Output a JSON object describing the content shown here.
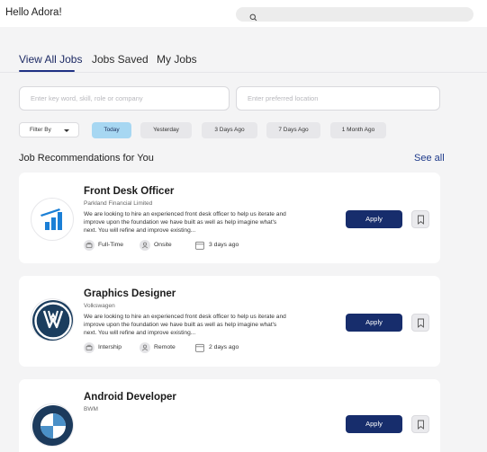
{
  "header": {
    "greeting": "Hello Adora!",
    "search_icon": "search-icon"
  },
  "tabs": [
    {
      "label": "View All Jobs",
      "active": true
    },
    {
      "label": "Jobs Saved",
      "active": false
    },
    {
      "label": "My Jobs",
      "active": false
    }
  ],
  "search": {
    "keyword_placeholder": "Enter key word, skill, role or company",
    "location_placeholder": "Enter preferred location"
  },
  "filters": {
    "filter_by_label": "Filter By",
    "chips": [
      {
        "label": "Today",
        "active": true
      },
      {
        "label": "Yesterday",
        "active": false
      },
      {
        "label": "3 Days Ago",
        "active": false
      },
      {
        "label": "7 Days Ago",
        "active": false
      },
      {
        "label": "1 Month Ago",
        "active": false
      }
    ]
  },
  "recommendations": {
    "heading": "Job Recommendations for You",
    "see_all": "See all"
  },
  "jobs": [
    {
      "title": "Front Desk Officer",
      "company": "Parkland Financial Limited",
      "description": "We are looking to hire an experienced front desk officer to help us iterate and improve upon the foundation we have built as well as help imagine what's next. You will refine and improve existing...",
      "type": "Full-Time",
      "mode": "Onsite",
      "posted": "3 days ago",
      "apply_label": "Apply",
      "logo_icon": "parkland-logo-icon"
    },
    {
      "title": "Graphics Designer",
      "company": "Volkswagen",
      "description": "We are looking to hire an experienced front desk officer to help us iterate and improve upon the foundation we have built as well as help imagine what's next. You will refine and improve existing...",
      "type": "Intership",
      "mode": "Remote",
      "posted": "2 days ago",
      "apply_label": "Apply",
      "logo_icon": "volkswagen-logo-icon"
    },
    {
      "title": "Android Developer",
      "company": "BWM",
      "apply_label": "Apply",
      "logo_icon": "bmw-logo-icon"
    }
  ],
  "colors": {
    "primary": "#172d6c",
    "chip_active": "#a7d7f2",
    "background": "#f4f4f5"
  }
}
